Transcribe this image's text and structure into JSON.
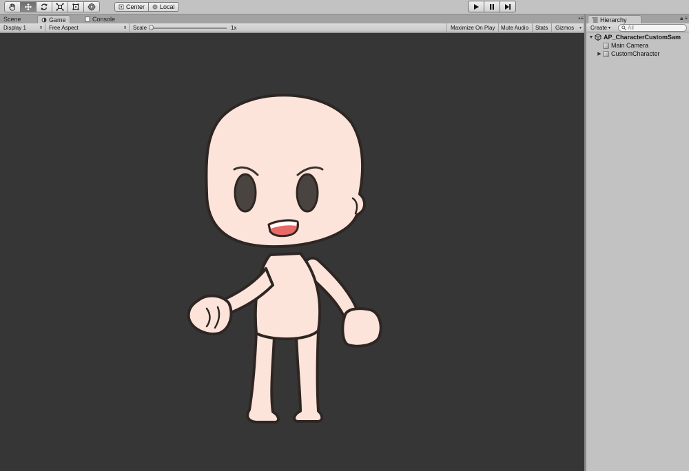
{
  "toolbar": {
    "tools": [
      {
        "icon": "hand-icon",
        "active": false
      },
      {
        "icon": "move-icon",
        "active": true
      },
      {
        "icon": "rotate-icon",
        "active": false
      },
      {
        "icon": "scale-icon",
        "active": false
      },
      {
        "icon": "rect-icon",
        "active": false
      },
      {
        "icon": "transform-icon",
        "active": false
      }
    ],
    "pivot_label": "Center",
    "space_label": "Local",
    "play_icon": "play-icon",
    "pause_icon": "pause-icon",
    "step_icon": "step-icon"
  },
  "tabs": {
    "scene_label": "Scene",
    "game_label": "Game",
    "console_label": "Console",
    "active": "Game"
  },
  "game_toolbar": {
    "display_label": "Display 1",
    "aspect_label": "Free Aspect",
    "scale_label": "Scale",
    "scale_value": "1x",
    "maximize_label": "Maximize On Play",
    "mute_label": "Mute Audio",
    "stats_label": "Stats",
    "gizmos_label": "Gizmos"
  },
  "hierarchy": {
    "tab_label": "Hierarchy",
    "create_label": "Create",
    "search_placeholder": "All",
    "scene_name": "AP_CharacterCustomSam",
    "items": [
      {
        "label": "Main Camera",
        "expandable": false
      },
      {
        "label": "CustomCharacter",
        "expandable": true
      }
    ]
  },
  "colors": {
    "viewport_bg": "#363636",
    "skin": "#fde4da",
    "outline": "#2e2623",
    "eyes": "#4a4441",
    "mouth": "#e86a66"
  }
}
